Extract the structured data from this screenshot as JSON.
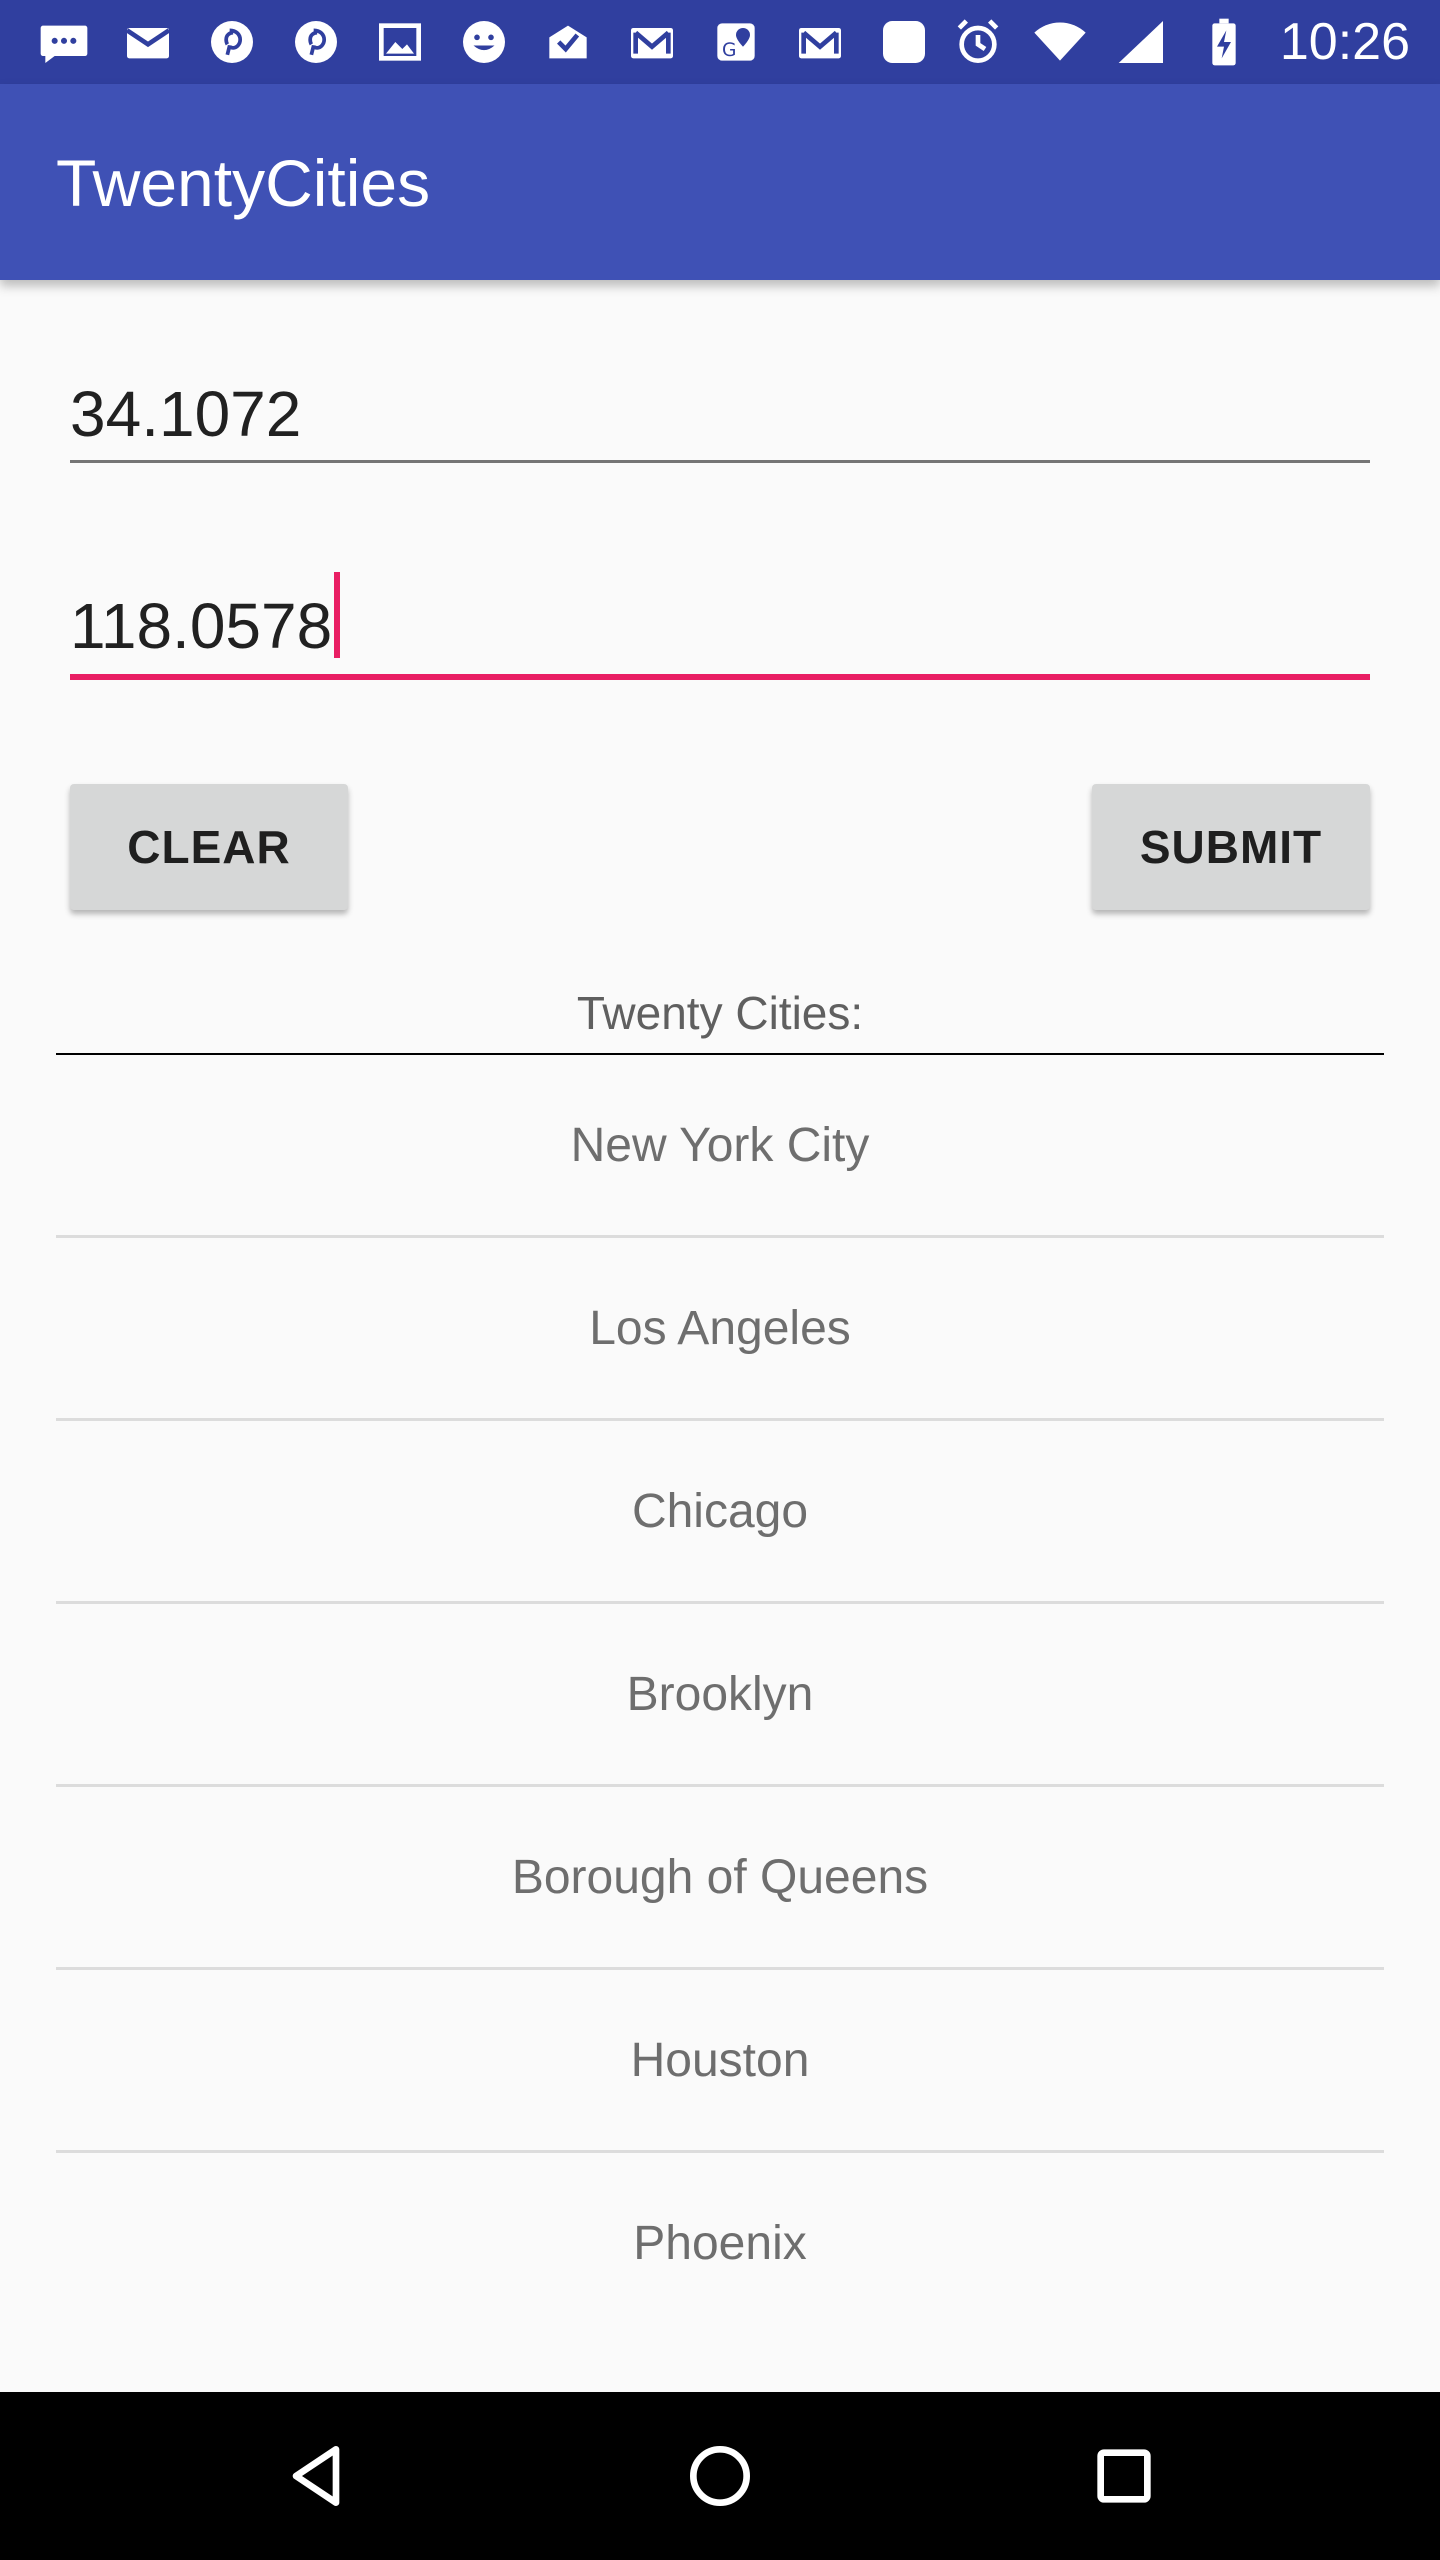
{
  "status_bar": {
    "time": "10:26",
    "notification_icons": [
      "chat-bubble-icon",
      "gmail-icon",
      "pinterest-icon",
      "pinterest-icon",
      "image-icon",
      "emoji-icon",
      "mail-check-icon",
      "gmail-icon",
      "maps-icon",
      "gmail-icon",
      "app-icon"
    ],
    "system_icons": [
      "alarm-icon",
      "wifi-icon",
      "signal-icon",
      "battery-charging-icon"
    ]
  },
  "app_bar": {
    "title": "TwentyCities",
    "background": "#3f51b5",
    "status_background": "#303f9f"
  },
  "form": {
    "latitude_value": "34.1072",
    "longitude_value": "118.0578",
    "accent_color": "#e91e63"
  },
  "buttons": {
    "clear_label": "CLEAR",
    "submit_label": "SUBMIT"
  },
  "list": {
    "header": "Twenty Cities:",
    "cities": [
      "New York City",
      "Los Angeles",
      "Chicago",
      "Brooklyn",
      "Borough of Queens",
      "Houston",
      "Phoenix"
    ]
  },
  "nav_bar": {
    "buttons": [
      "back-icon",
      "home-icon",
      "recents-icon"
    ]
  }
}
